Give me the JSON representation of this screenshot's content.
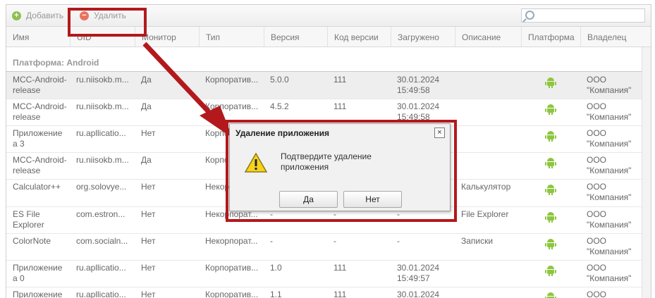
{
  "toolbar": {
    "add_label": "Добавить",
    "delete_label": "Удалить",
    "search_placeholder": ""
  },
  "columns": [
    "Имя",
    "UID",
    "Монитор",
    "Тип",
    "Версия",
    "Код версии",
    "Загружено",
    "Описание",
    "Платформа",
    "Владелец"
  ],
  "group_label": "Платформа: Android",
  "rows": [
    {
      "name": "MCC-Android-\nrelease",
      "uid": "ru.niisokb.m...",
      "monitor": "Да",
      "type": "Корпоратив...",
      "version": "5.0.0",
      "code": "111",
      "uploaded": "30.01.2024\n15:49:58",
      "description": "",
      "owner": "ООО\n\"Компания\""
    },
    {
      "name": "MCC-Android-\nrelease",
      "uid": "ru.niisokb.m...",
      "monitor": "Да",
      "type": "Корпоратив...",
      "version": "4.5.2",
      "code": "111",
      "uploaded": "30.01.2024\n15:49:58",
      "description": "",
      "owner": "ООО\n\"Компания\""
    },
    {
      "name": "Приложение\nа 3",
      "uid": "ru.apllicatio...",
      "monitor": "Нет",
      "type": "Корпоратив...",
      "version": "",
      "code": "",
      "uploaded": "",
      "description": "",
      "owner": "ООО\n\"Компания\""
    },
    {
      "name": "MCC-Android-\nrelease",
      "uid": "ru.niisokb.m...",
      "monitor": "Да",
      "type": "Корпоратив...",
      "version": "",
      "code": "",
      "uploaded": "",
      "description": "",
      "owner": "ООО\n\"Компания\""
    },
    {
      "name": "Calculator++",
      "uid": "org.solovye...",
      "monitor": "Нет",
      "type": "Некорпорат...",
      "version": "",
      "code": "",
      "uploaded": "",
      "description": "Калькулятор",
      "owner": "ООО\n\"Компания\""
    },
    {
      "name": "ES File\nExplorer",
      "uid": "com.estron...",
      "monitor": "Нет",
      "type": "Некорпорат...",
      "version": "-",
      "code": "-",
      "uploaded": "-",
      "description": "File Explorer",
      "owner": "ООО\n\"Компания\""
    },
    {
      "name": "ColorNote",
      "uid": "com.socialn...",
      "monitor": "Нет",
      "type": "Некорпорат...",
      "version": "-",
      "code": "-",
      "uploaded": "-",
      "description": "Записки",
      "owner": "ООО\n\"Компания\""
    },
    {
      "name": "Приложение\nа 0",
      "uid": "ru.apllicatio...",
      "monitor": "Нет",
      "type": "Корпоратив...",
      "version": "1.0",
      "code": "111",
      "uploaded": "30.01.2024\n15:49:57",
      "description": "",
      "owner": "ООО\n\"Компания\""
    },
    {
      "name": "Приложение",
      "uid": "ru.apllicatio...",
      "monitor": "Нет",
      "type": "Корпоратив...",
      "version": "1.1",
      "code": "111",
      "uploaded": "30.01.2024",
      "description": "",
      "owner": "ООО"
    }
  ],
  "dialog": {
    "title": "Удаление приложения",
    "message": "Подтвердите удаление\nприложения",
    "yes_label": "Да",
    "no_label": "Нет",
    "close_glyph": "×"
  },
  "colors": {
    "highlight": "#b3191c",
    "android": "#8dc63f",
    "add": "#8cc152",
    "delete": "#e9735f"
  }
}
